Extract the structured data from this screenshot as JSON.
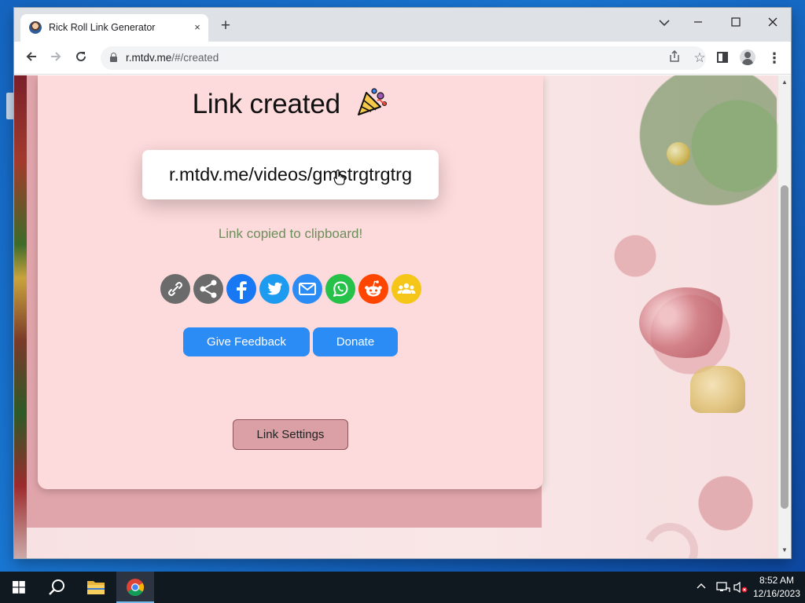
{
  "browser": {
    "tab_title": "Rick Roll Link Generator",
    "tab_close": "×",
    "new_tab": "+",
    "url_host": "r.mtdv.me",
    "url_path": "/#/created"
  },
  "page": {
    "title": "Link created",
    "generated_link": "r.mtdv.me/videos/gmstrgtrgtrg",
    "copied_message": "Link copied to clipboard!",
    "share_buttons": [
      {
        "name": "copy-link",
        "icon": "link-icon",
        "color": "#6b6b6b"
      },
      {
        "name": "share",
        "icon": "share-icon",
        "color": "#6b6b6b"
      },
      {
        "name": "facebook",
        "icon": "facebook-icon",
        "color": "#1877f2"
      },
      {
        "name": "twitter",
        "icon": "twitter-icon",
        "color": "#1d9bf0"
      },
      {
        "name": "email",
        "icon": "email-icon",
        "color": "#2c8cf5"
      },
      {
        "name": "whatsapp",
        "icon": "whatsapp-icon",
        "color": "#25c148"
      },
      {
        "name": "reddit",
        "icon": "reddit-icon",
        "color": "#ff4500"
      },
      {
        "name": "group",
        "icon": "group-icon",
        "color": "#f5c518"
      }
    ],
    "feedback_label": "Give Feedback",
    "donate_label": "Donate",
    "settings_label": "Link Settings"
  },
  "taskbar": {
    "time": "8:52 AM",
    "date": "12/16/2023"
  },
  "colors": {
    "card_bg": "#fddadb",
    "accent_blue": "#2c8cf5",
    "copied_green": "#6b8f5a",
    "settings_bg": "#dba0a5"
  }
}
